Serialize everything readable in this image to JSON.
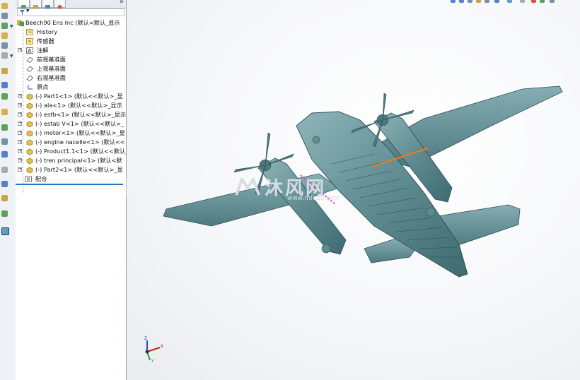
{
  "feature_tree": {
    "root": {
      "label": "Beech90 Ens Inc  (默认<默认_显示"
    },
    "items": [
      {
        "label": "History"
      },
      {
        "label": "传感器"
      },
      {
        "label": "注解"
      },
      {
        "label": "前视基准面"
      },
      {
        "label": "上视基准面"
      },
      {
        "label": "右视基准面"
      },
      {
        "label": "原点"
      },
      {
        "label": "(-) Part1<1> (默认<<默认>_显"
      },
      {
        "label": "(-) ala<1> (默认<<默认>_显示"
      },
      {
        "label": "(-) estb<1> (默认<<默认>_显示"
      },
      {
        "label": "(-) estab V<1> (默认<<默认>_"
      },
      {
        "label": "(-) motor<1> (默认<<默认>_显"
      },
      {
        "label": "(-) engine nacelle<1> (默认<<"
      },
      {
        "label": "(-) Product1.1<1> (默认<<默认_"
      },
      {
        "label": "(-) tren principal<1> (默认<默"
      },
      {
        "label": "(-) Part2<1> (默认<<默认>_显"
      },
      {
        "label": "配合"
      }
    ],
    "expand_symbol": "»"
  },
  "triad": {
    "z": "Z",
    "y": "Y",
    "x": "X"
  },
  "watermark": {
    "text": "沐风网",
    "url": "www.mfcad.com"
  },
  "colors": {
    "model": "#5f8c91",
    "highlight": "#ee7a1b",
    "magenta": "#d63bd6",
    "selection_line": "#2f6fbf"
  }
}
